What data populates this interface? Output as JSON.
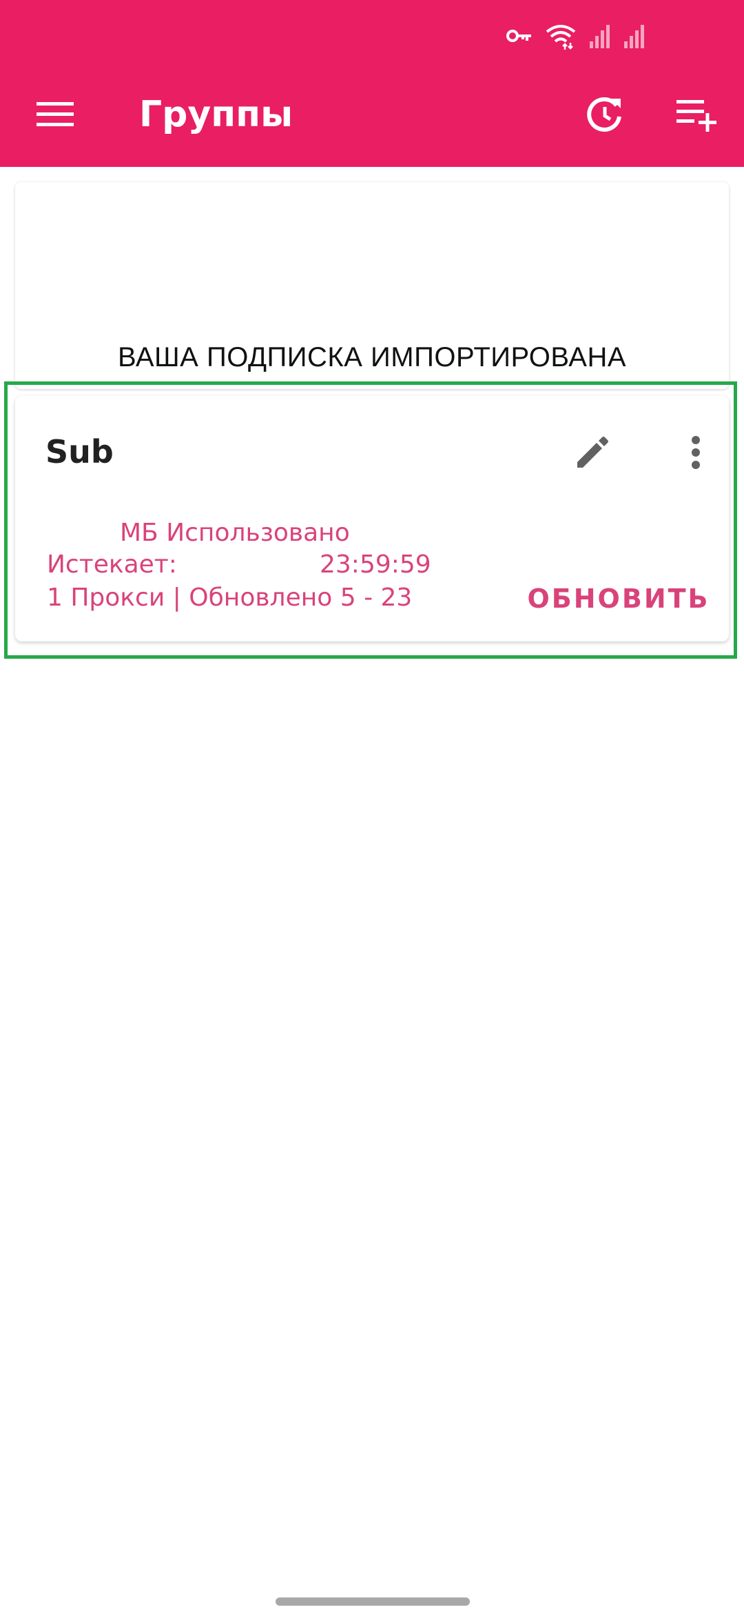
{
  "app": {
    "title": "Группы",
    "accent_color": "#e91e63",
    "text_accent_color": "#d9437a"
  },
  "status_bar": {
    "icons": [
      "vpn-key-icon",
      "wifi-icon",
      "signal-icon-sim1",
      "signal-icon-sim2"
    ]
  },
  "toolbar": {
    "menu_icon": "menu-icon",
    "actions": [
      "refresh-icon",
      "playlist-add-icon"
    ]
  },
  "banner": {
    "text": "ВАША ПОДПИСКА ИМПОРТИРОВАНА"
  },
  "group": {
    "name": "Sub",
    "usage": "МБ Использовано",
    "expires_label": "Истекает:",
    "expires_time": "23:59:59",
    "summary": "1 Прокси | Обновлено 5 - 23",
    "update_label": "ОБНОВИТЬ",
    "actions": [
      "edit-icon",
      "more-vert-icon"
    ]
  }
}
